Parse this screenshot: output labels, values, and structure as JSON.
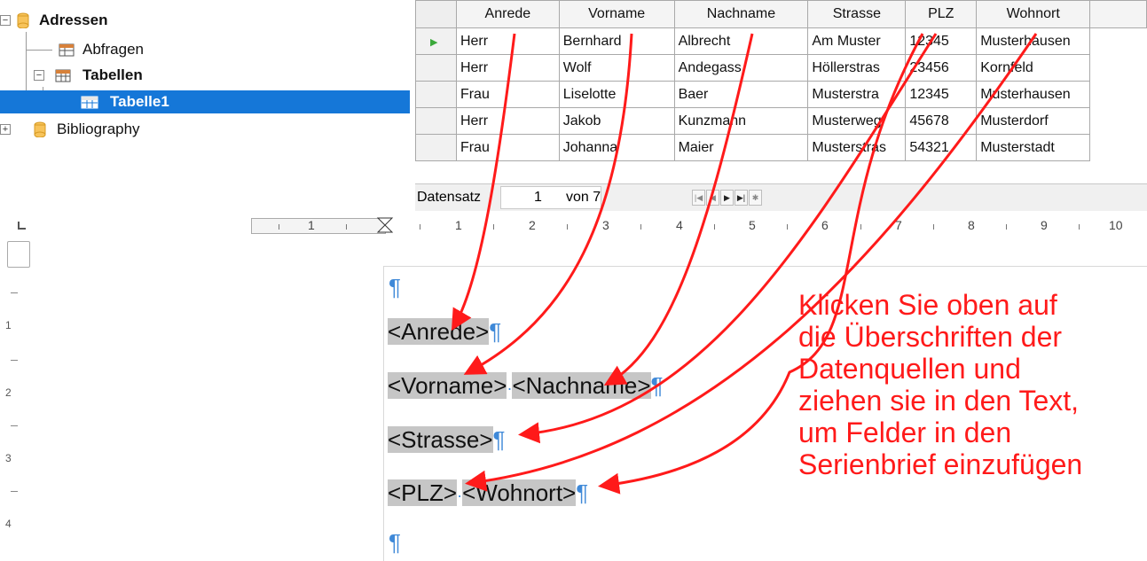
{
  "tree": {
    "items": [
      {
        "label": "Adressen",
        "icon": "database-icon",
        "bold": true
      },
      {
        "label": "Abfragen",
        "icon": "queries-icon",
        "bold": false
      },
      {
        "label": "Tabellen",
        "icon": "tables-icon",
        "bold": true
      },
      {
        "label": "Tabelle1",
        "icon": "table-icon",
        "bold": true,
        "selected": true
      },
      {
        "label": "Bibliography",
        "icon": "database-icon",
        "bold": false
      }
    ]
  },
  "grid": {
    "columns": [
      "Anrede",
      "Vorname",
      "Nachname",
      "Strasse",
      "PLZ",
      "Wohnort"
    ],
    "rows": [
      [
        "Herr",
        "Bernhard",
        "Albrecht",
        "Am Muster",
        "12345",
        "Musterhausen"
      ],
      [
        "Herr",
        "Wolf",
        "Andegass",
        "Höllerstras",
        "23456",
        "Kornfeld"
      ],
      [
        "Frau",
        "Liselotte",
        "Baer",
        "Musterstra",
        "12345",
        "Musterhausen"
      ],
      [
        "Herr",
        "Jakob",
        "Kunzmann",
        "Musterweg",
        "45678",
        "Musterdorf"
      ],
      [
        "Frau",
        "Johanna",
        "Maier",
        "Musterstras",
        "54321",
        "Musterstadt"
      ]
    ],
    "navigator": {
      "label": "Datensatz",
      "current": "1",
      "of_label": "von 7"
    }
  },
  "ruler": {
    "numbers": [
      "1",
      "1",
      "2",
      "3",
      "4",
      "5",
      "6",
      "7",
      "8",
      "9",
      "10"
    ]
  },
  "vruler": {
    "numbers": [
      "1",
      "2",
      "3",
      "4"
    ]
  },
  "document": {
    "pilcrow": "¶",
    "field_anrede": "<Anrede>",
    "field_vorname": "<Vorname>",
    "field_nachname": "<Nachname>",
    "field_strasse": "<Strasse>",
    "field_plz": "<PLZ>",
    "field_wohnort": "<Wohnort>",
    "space_mark": "·"
  },
  "annotation": {
    "lines": [
      "Klicken Sie oben auf",
      "die Überschriften der",
      "Datenquellen und",
      "ziehen sie in den Text,",
      "um Felder in den",
      "Serienbrief einzufügen"
    ],
    "color": "#ff1a1a"
  },
  "colors": {
    "selection": "#1577d8",
    "field_bg": "#c6c6c6",
    "pilcrow": "#3f89d8",
    "arrow": "#ff1a1a"
  }
}
